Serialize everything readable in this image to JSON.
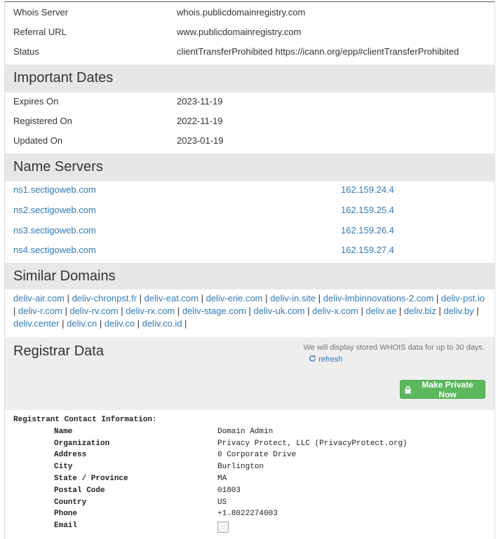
{
  "registrar_rows": [
    {
      "label": "Whois Server",
      "value": "whois.publicdomainregistry.com"
    },
    {
      "label": "Referral URL",
      "value": "www.publicdomainregistry.com"
    },
    {
      "label": "Status",
      "value": "clientTransferProhibited https://icann.org/epp#clientTransferProhibited"
    }
  ],
  "important_dates": {
    "title": "Important Dates",
    "rows": [
      {
        "label": "Expires On",
        "value": "2023-11-19"
      },
      {
        "label": "Registered On",
        "value": "2022-11-19"
      },
      {
        "label": "Updated On",
        "value": "2023-01-19"
      }
    ]
  },
  "name_servers": {
    "title": "Name Servers",
    "rows": [
      {
        "host": "ns1.sectigoweb.com",
        "ip": "162.159.24.4"
      },
      {
        "host": "ns2.sectigoweb.com",
        "ip": "162.159.25.4"
      },
      {
        "host": "ns3.sectigoweb.com",
        "ip": "162.159.26.4"
      },
      {
        "host": "ns4.sectigoweb.com",
        "ip": "162.159.27.4"
      }
    ]
  },
  "similar_domains": {
    "title": "Similar Domains",
    "separator": "|",
    "items": [
      "deliv-air.com",
      "deliv-chronpst.fr",
      "deliv-eat.com",
      "deliv-erie.com",
      "deliv-in.site",
      "deliv-lmbinnovations-2.com",
      "deliv-pst.io",
      "deliv-r.com",
      "deliv-rv.com",
      "deliv-rx.com",
      "deliv-stage.com",
      "deliv-uk.com",
      "deliv-x.com",
      "deliv.ae",
      "deliv.biz",
      "deliv.by",
      "deliv.center",
      "deliv.cn",
      "deliv.co",
      "deliv.co.id"
    ]
  },
  "registrar_data": {
    "title": "Registrar Data",
    "note": "We will display stored WHOIS data for up to 30 days.",
    "refresh_label": "refresh",
    "refresh_icon": "refresh-icon",
    "private_button_label": "Make Private Now",
    "private_button_icon": "lock-icon",
    "accent_color": "#5cb85c"
  },
  "raw_whois": {
    "header": "Registrant Contact Information:",
    "fields": [
      {
        "label": "Name",
        "value": "Domain Admin"
      },
      {
        "label": "Organization",
        "value": "Privacy Protect, LLC (PrivacyProtect.org)"
      },
      {
        "label": "Address",
        "value": "0 Corporate Drive"
      },
      {
        "label": "City",
        "value": "Burlington"
      },
      {
        "label": "State / Province",
        "value": "MA"
      },
      {
        "label": "Postal Code",
        "value": "01803"
      },
      {
        "label": "Country",
        "value": "US"
      },
      {
        "label": "Phone",
        "value": "+1.8022274003"
      },
      {
        "label": "Email",
        "value": ""
      }
    ]
  }
}
